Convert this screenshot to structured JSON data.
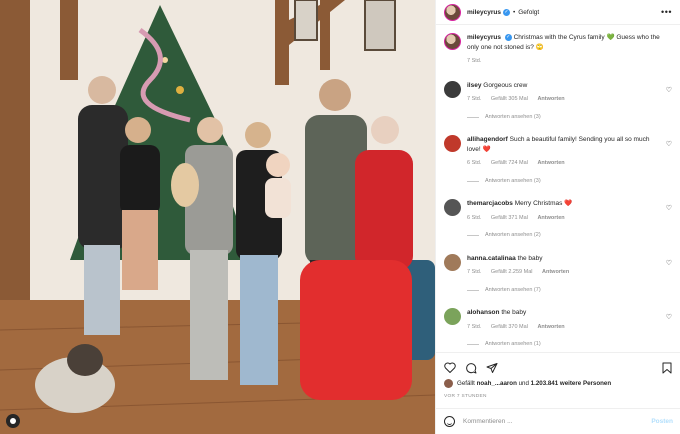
{
  "post": {
    "username": "mileycyrus",
    "follow_status": "Gefolgt",
    "more_icon": "more-options-icon"
  },
  "caption": {
    "username": "mileycyrus",
    "text": "Christmas with the Cyrus family",
    "text2": "Guess who the only one not stoned is?",
    "emoji1": "💚",
    "emoji2": "🙄",
    "time": "7 Std."
  },
  "comments": [
    {
      "user": "ilsey",
      "text": "Gorgeous crew",
      "emoji": "",
      "time": "7 Std.",
      "likes": "Gefällt 305 Mal",
      "reply": "Antworten",
      "view_replies": "Antworten ansehen (3)",
      "avatar_color": "#3b3b3b"
    },
    {
      "user": "allihagendorf",
      "text": "Such a beautiful family! Sending you all so much love!",
      "emoji": "❤️",
      "time": "6 Std.",
      "likes": "Gefällt 724 Mal",
      "reply": "Antworten",
      "view_replies": "Antworten ansehen (3)",
      "avatar_color": "#c0392b"
    },
    {
      "user": "themarcjacobs",
      "text": "Merry Christmas",
      "emoji": "❤️",
      "time": "6 Std.",
      "likes": "Gefällt 371 Mal",
      "reply": "Antworten",
      "view_replies": "Antworten ansehen (2)",
      "avatar_color": "#555555"
    },
    {
      "user": "hanna.catalinaa",
      "text": "the baby",
      "emoji": "",
      "time": "7 Std.",
      "likes": "Gefällt 2.259 Mal",
      "reply": "Antworten",
      "view_replies": "Antworten ansehen (7)",
      "avatar_color": "#a07a5a"
    },
    {
      "user": "alohanson",
      "text": "the baby",
      "emoji": "",
      "time": "7 Std.",
      "likes": "Gefällt 370 Mal",
      "reply": "Antworten",
      "view_replies": "Antworten ansehen (1)",
      "avatar_color": "#7ba35b"
    }
  ],
  "actions": {
    "like_icon": "heart-icon",
    "comment_icon": "comment-icon",
    "share_icon": "share-icon",
    "save_icon": "bookmark-icon"
  },
  "likes": {
    "prefix": "Gefällt",
    "user": "noah_...aaron",
    "mid": "und",
    "count": "1.203.841 weitere Personen"
  },
  "time_ago": "VOR 7 STUNDEN",
  "add_comment": {
    "placeholder": "Kommentieren ...",
    "post_label": "Posten"
  }
}
